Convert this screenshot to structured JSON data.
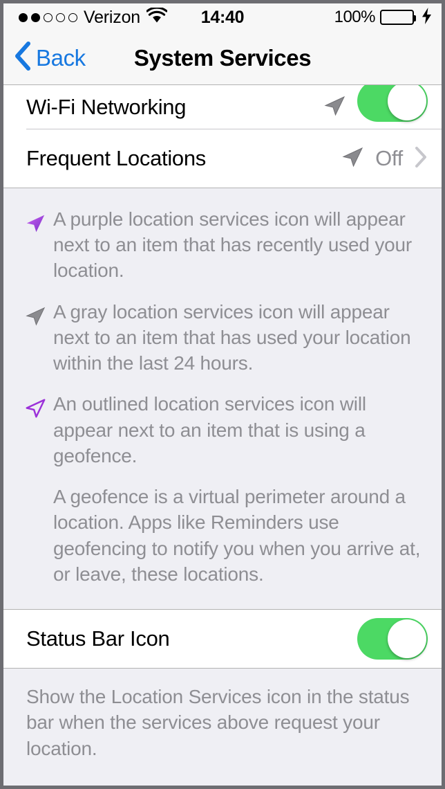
{
  "status_bar": {
    "signal_dots_filled": 2,
    "signal_dots_empty": 3,
    "carrier": "Verizon",
    "wifi_icon": "wifi-icon",
    "time": "14:40",
    "battery_percent": "100%",
    "battery_level": 100,
    "battery_icon": "battery-icon",
    "charging_icon": "lightning-bolt-icon",
    "battery_color": "#4CD964"
  },
  "nav_bar": {
    "back_icon": "chevron-left-icon",
    "back_label": "Back",
    "title": "System Services",
    "tint_color": "#1778E0"
  },
  "services_section": {
    "rows": [
      {
        "title": "Wi-Fi Networking",
        "icon": "location-arrow-gray-icon",
        "control": "toggle",
        "toggle_on": true,
        "clipped": true
      },
      {
        "title": "Frequent Locations",
        "icon": "location-arrow-gray-icon",
        "control": "disclosure",
        "value": "Off",
        "chevron_icon": "chevron-right-icon",
        "clipped": false
      }
    ]
  },
  "legend_section": {
    "items": [
      {
        "icon": "location-arrow-purple-filled-icon",
        "text": "A purple location services icon will appear next to an item that has recently used your location."
      },
      {
        "icon": "location-arrow-gray-filled-icon",
        "text": "A gray location services icon will appear next to an item that has used your location within the last 24 hours."
      },
      {
        "icon": "location-arrow-purple-outlined-icon",
        "text": "An outlined location services icon will appear next to an item that is using a geofence."
      }
    ],
    "paragraph": "A geofence is a virtual perimeter around a location. Apps like Reminders use geofencing to notify you when you arrive at, or leave, these locations."
  },
  "status_bar_icon_section": {
    "row": {
      "title": "Status Bar Icon",
      "control": "toggle",
      "toggle_on": true
    },
    "footer": "Show the Location Services icon in the status bar when the services above request your location."
  },
  "colors": {
    "toggle_on": "#4CD964",
    "group_background": "#EFEFF4",
    "row_background": "#FFFFFF",
    "secondary_text": "#8E8E93",
    "accent": "#1778E0",
    "purple_arrow": "#9B30D9"
  }
}
